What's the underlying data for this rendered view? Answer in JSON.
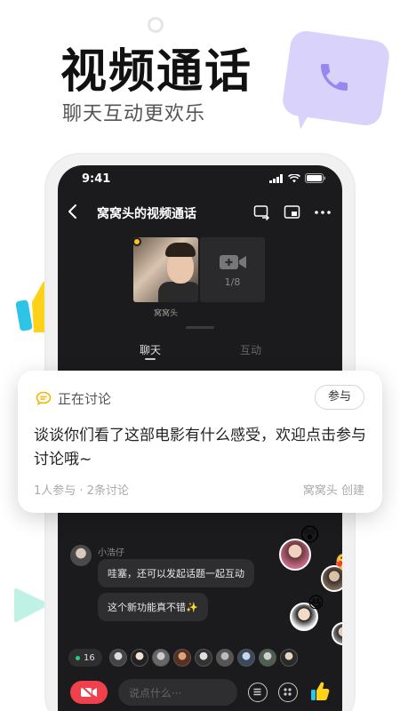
{
  "hero": {
    "title": "视频通话",
    "subtitle": "聊天互动更欢乐"
  },
  "status_bar": {
    "time": "9:41"
  },
  "nav": {
    "title": "窝窝头的视频通话"
  },
  "video": {
    "participant_name": "窝窝头",
    "slot_count": "1/8"
  },
  "tabs": [
    {
      "label": "聊天",
      "active": true
    },
    {
      "label": "互动",
      "active": false
    }
  ],
  "topic_card": {
    "status": "正在讨论",
    "join_label": "参与",
    "text": "谈谈你们看了这部电影有什么感受，欢迎点击参与讨论哦~",
    "stats": "1人参与 · 2条讨论",
    "creator": "窝窝头 创建"
  },
  "chat": {
    "sender": "小浩仔",
    "messages": [
      "哇塞，还可以发起话题一起互动",
      "这个新功能真不错✨"
    ]
  },
  "participants": {
    "count": "16"
  },
  "input": {
    "placeholder": "说点什么···"
  },
  "colors": {
    "accent": "#ffc21a",
    "danger": "#f0404b",
    "screen_bg": "#1b1b1d"
  }
}
